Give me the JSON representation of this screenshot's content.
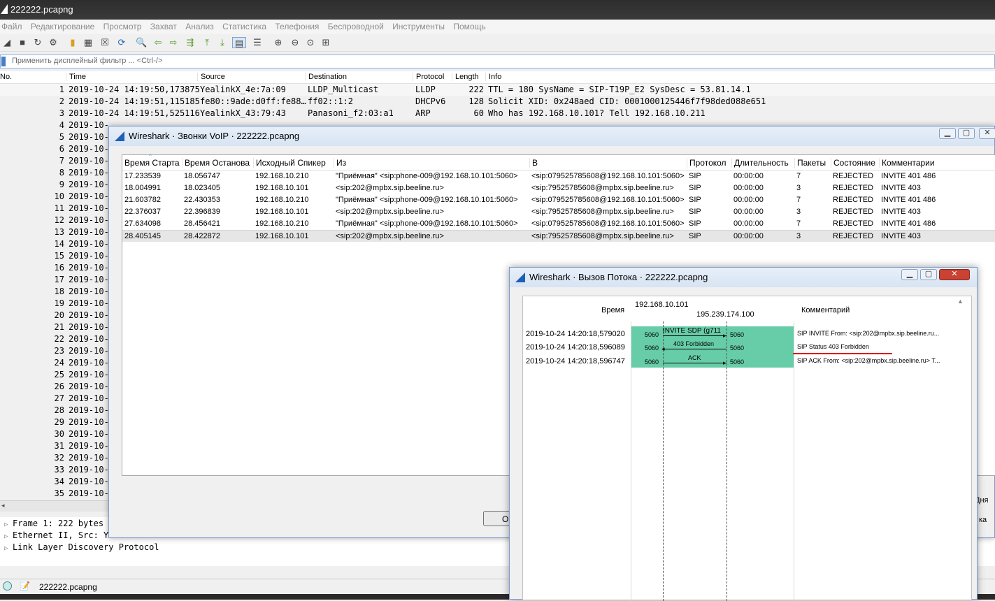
{
  "main": {
    "title": "222222.pcapng",
    "menu": [
      "Файл",
      "Редактирование",
      "Просмотр",
      "Захват",
      "Анализ",
      "Статистика",
      "Телефония",
      "Беспроводной",
      "Инструменты",
      "Помощь"
    ],
    "filter_placeholder": "Применить дисплейный фильтр ... <Ctrl-/>",
    "columns": {
      "no": "No.",
      "time": "Time",
      "source": "Source",
      "destination": "Destination",
      "protocol": "Protocol",
      "length": "Length",
      "info": "Info"
    },
    "packets": [
      {
        "no": "1",
        "time": "2019-10-24 14:19:50,173875",
        "source": "YealinkX_4e:7a:09",
        "destination": "LLDP_Multicast",
        "protocol": "LLDP",
        "length": "222",
        "info": "TTL = 180 SysName = SIP-T19P_E2 SysDesc = 53.81.14.1"
      },
      {
        "no": "2",
        "time": "2019-10-24 14:19:51,115185",
        "source": "fe80::9ade:d0ff:fe88…",
        "destination": "ff02::1:2",
        "protocol": "DHCPv6",
        "length": "128",
        "info": "Solicit XID: 0x248aed CID: 0001000125446f7f98ded088e651"
      },
      {
        "no": "3",
        "time": "2019-10-24 14:19:51,525116",
        "source": "YealinkX_43:79:43",
        "destination": "Panasoni_f2:03:a1",
        "protocol": "ARP",
        "length": "60",
        "info": "Who has 192.168.10.101? Tell 192.168.10.211"
      }
    ],
    "row_numbers": [
      "4",
      "5",
      "6",
      "7",
      "8",
      "9",
      "10",
      "11",
      "12",
      "13",
      "14",
      "15",
      "16",
      "17",
      "18",
      "19",
      "20",
      "21",
      "22",
      "23",
      "24",
      "25",
      "26",
      "27",
      "28",
      "29",
      "30",
      "31",
      "32",
      "33",
      "34",
      "35"
    ],
    "row_time_prefix": "2019-10-",
    "details": [
      "Frame 1: 222 bytes o",
      "Ethernet II, Src: Ye",
      "Link Layer Discovery Protocol"
    ],
    "status_file": "222222.pcapng"
  },
  "voip": {
    "title": "Wireshark · Звонки VoIP · 222222.pcapng",
    "columns": {
      "start": "Время Старта",
      "stop": "Время Останова",
      "speaker": "Исходный Спикер",
      "from": "Из",
      "to": "В",
      "protocol": "Протокол",
      "duration": "Длительность",
      "packets": "Пакеты",
      "state": "Состояние",
      "comments": "Комментарии"
    },
    "rows": [
      {
        "start": "17.233539",
        "stop": "18.056747",
        "speaker": "192.168.10.210",
        "from": "\"Приёмная\" <sip:phone-009@192.168.10.101:5060>",
        "to": "<sip:079525785608@192.168.10.101:5060>",
        "protocol": "SIP",
        "duration": "00:00:00",
        "packets": "7",
        "state": "REJECTED",
        "comments": "INVITE 401 486"
      },
      {
        "start": "18.004991",
        "stop": "18.023405",
        "speaker": "192.168.10.101",
        "from": "<sip:202@mpbx.sip.beeline.ru>",
        "to": "<sip:79525785608@mpbx.sip.beeline.ru>",
        "protocol": "SIP",
        "duration": "00:00:00",
        "packets": "3",
        "state": "REJECTED",
        "comments": "INVITE 403"
      },
      {
        "start": "21.603782",
        "stop": "22.430353",
        "speaker": "192.168.10.210",
        "from": "\"Приёмная\" <sip:phone-009@192.168.10.101:5060>",
        "to": "<sip:079525785608@192.168.10.101:5060>",
        "protocol": "SIP",
        "duration": "00:00:00",
        "packets": "7",
        "state": "REJECTED",
        "comments": "INVITE 401 486"
      },
      {
        "start": "22.376037",
        "stop": "22.396839",
        "speaker": "192.168.10.101",
        "from": "<sip:202@mpbx.sip.beeline.ru>",
        "to": "<sip:79525785608@mpbx.sip.beeline.ru>",
        "protocol": "SIP",
        "duration": "00:00:00",
        "packets": "3",
        "state": "REJECTED",
        "comments": "INVITE 403"
      },
      {
        "start": "27.634098",
        "stop": "28.456421",
        "speaker": "192.168.10.210",
        "from": "\"Приёмная\" <sip:phone-009@192.168.10.101:5060>",
        "to": "<sip:079525785608@192.168.10.101:5060>",
        "protocol": "SIP",
        "duration": "00:00:00",
        "packets": "7",
        "state": "REJECTED",
        "comments": "INVITE 401 486"
      },
      {
        "start": "28.405145",
        "stop": "28.422872",
        "speaker": "192.168.10.101",
        "from": "<sip:202@mpbx.sip.beeline.ru>",
        "to": "<sip:79525785608@mpbx.sip.beeline.ru>",
        "protocol": "SIP",
        "duration": "00:00:00",
        "packets": "3",
        "state": "REJECTED",
        "comments": "INVITE 403"
      }
    ],
    "close_label": "O",
    "right_clip_1": "Дня",
    "right_clip_2": "ка"
  },
  "flow": {
    "title": "Wireshark · Вызов Потока · 222222.pcapng",
    "col_time": "Время",
    "col_comment": "Комментарий",
    "host_a": "192.168.10.101",
    "host_b": "195.239.174.100",
    "events": [
      {
        "time": "2019-10-24 14:20:18,579020",
        "label": "INVITE SDP (g711",
        "port_a": "5060",
        "port_b": "5060",
        "comment": "SIP INVITE From: <sip:202@mpbx.sip.beeline.ru..."
      },
      {
        "time": "2019-10-24 14:20:18,596089",
        "label": "403 Forbidden",
        "port_a": "5060",
        "port_b": "5060",
        "comment": "SIP Status 403 Forbidden"
      },
      {
        "time": "2019-10-24 14:20:18,596747",
        "label": "ACK",
        "port_a": "5060",
        "port_b": "5060",
        "comment": "SIP ACK From: <sip:202@mpbx.sip.beeline.ru> T..."
      }
    ]
  }
}
